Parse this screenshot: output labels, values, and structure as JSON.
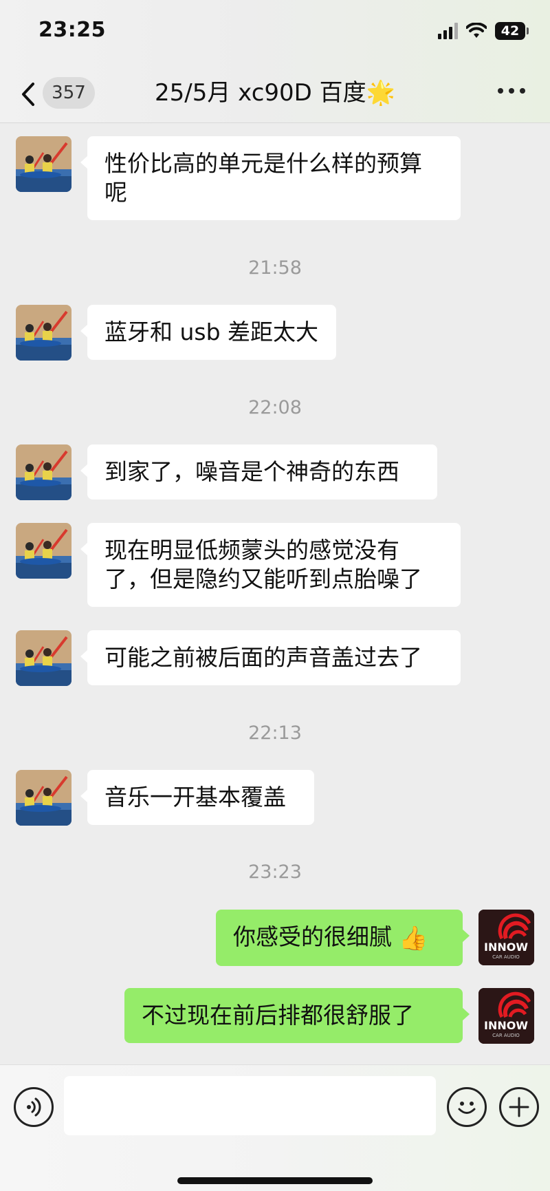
{
  "status": {
    "time": "23:25",
    "battery": "42",
    "signal_icon": "cellular-signal-icon",
    "wifi_icon": "wifi-icon"
  },
  "nav": {
    "back_icon": "chevron-left-icon",
    "unread_count": "357",
    "title": "25/5月 xc90D 百度🌟",
    "more_icon": "more-dots-icon"
  },
  "messages": [
    {
      "type": "in",
      "text": "性价比高的单元是什么样的预算呢"
    },
    {
      "type": "time",
      "text": "21:58"
    },
    {
      "type": "in",
      "text": "蓝牙和 usb 差距太大"
    },
    {
      "type": "time",
      "text": "22:08"
    },
    {
      "type": "in",
      "text": "到家了，噪音是个神奇的东西"
    },
    {
      "type": "in",
      "text": "现在明显低频蒙头的感觉没有了，但是隐约又能听到点胎噪了"
    },
    {
      "type": "in",
      "text": "可能之前被后面的声音盖过去了"
    },
    {
      "type": "time",
      "text": "22:13"
    },
    {
      "type": "in",
      "text": "音乐一开基本覆盖"
    },
    {
      "type": "time",
      "text": "23:23"
    },
    {
      "type": "out",
      "text": "你感受的很细腻",
      "emoji": "👍"
    },
    {
      "type": "out",
      "text": "不过现在前后排都很舒服了"
    }
  ],
  "avatar_right": {
    "logo_text": "INNOW",
    "logo_sub": "CAR AUDIO"
  },
  "input_bar": {
    "voice_icon": "voice-input-icon",
    "emoji_icon": "emoji-smile-icon",
    "plus_icon": "plus-circle-icon",
    "placeholder": ""
  },
  "colors": {
    "outgoing_bubble": "#95ec69",
    "incoming_bubble": "#ffffff",
    "background": "#ededed"
  }
}
